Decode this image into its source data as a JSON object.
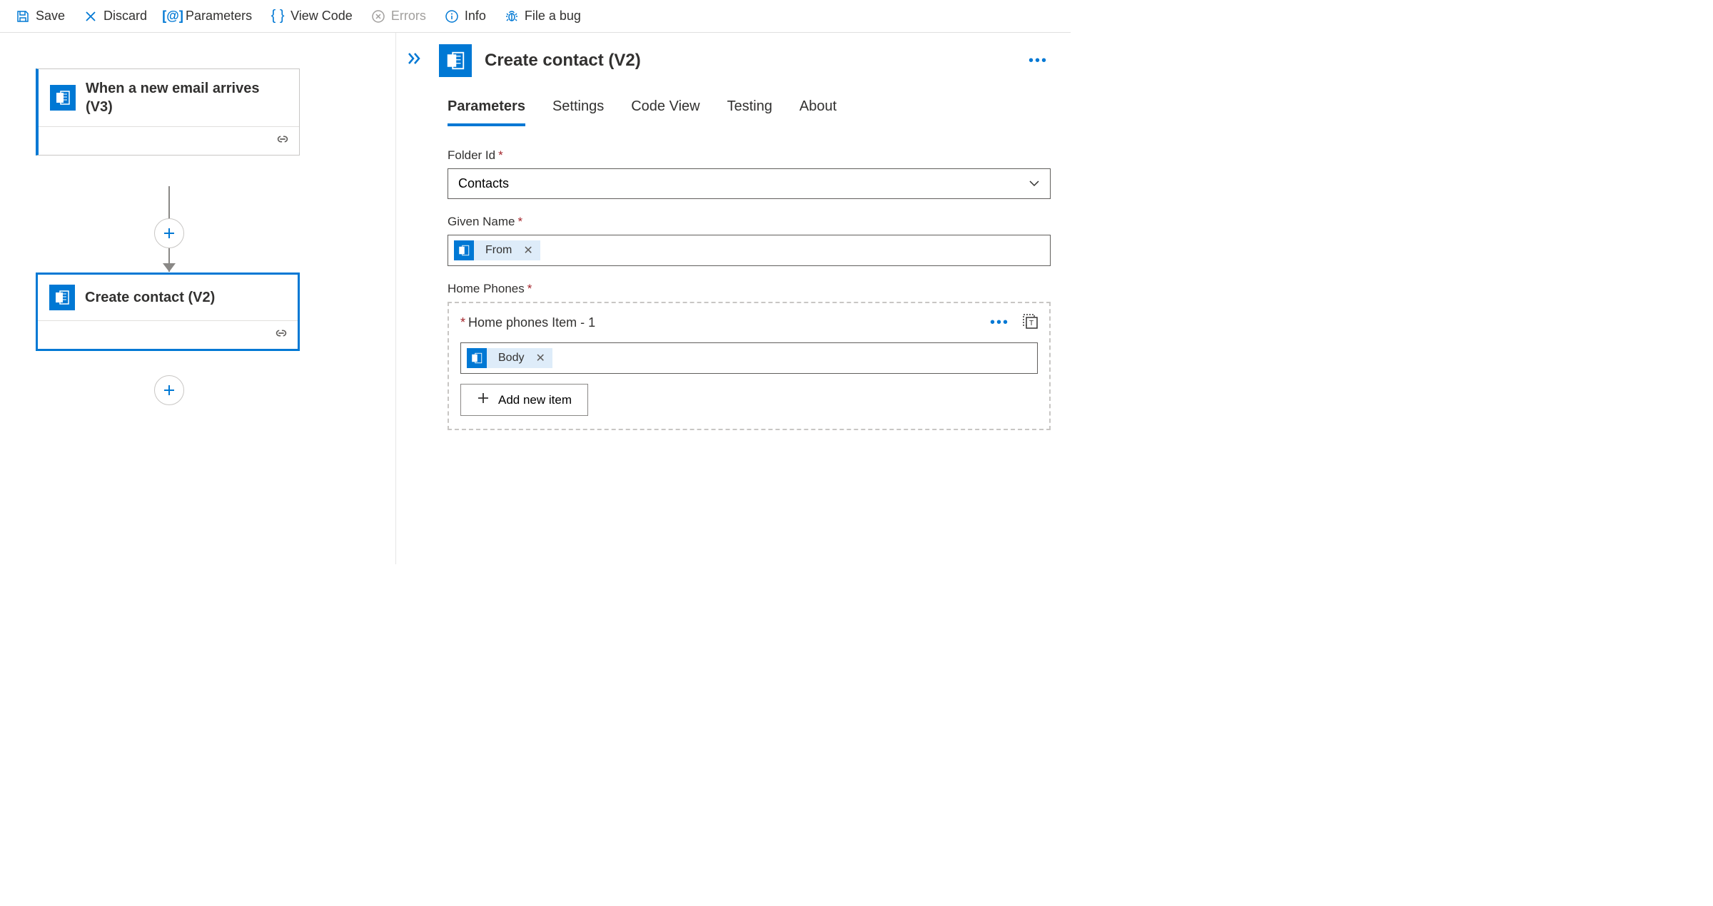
{
  "toolbar": {
    "save": "Save",
    "discard": "Discard",
    "parameters": "Parameters",
    "viewCode": "View Code",
    "errors": "Errors",
    "info": "Info",
    "fileBug": "File a bug"
  },
  "canvas": {
    "trigger": {
      "title": "When a new email arrives (V3)"
    },
    "action": {
      "title": "Create contact (V2)"
    }
  },
  "panel": {
    "title": "Create contact (V2)",
    "tabs": {
      "parameters": "Parameters",
      "settings": "Settings",
      "codeView": "Code View",
      "testing": "Testing",
      "about": "About"
    },
    "fields": {
      "folderId": {
        "label": "Folder Id",
        "value": "Contacts"
      },
      "givenName": {
        "label": "Given Name",
        "token": "From"
      },
      "homePhones": {
        "label": "Home Phones",
        "itemLabel": "Home phones Item - 1",
        "token": "Body",
        "addButton": "Add new item"
      }
    }
  }
}
